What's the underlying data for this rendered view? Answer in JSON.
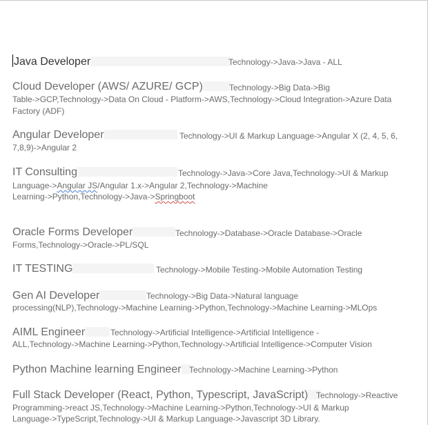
{
  "jobs": [
    {
      "title": "Java Developer",
      "lines": [
        "Technology->Java->Java - ALL"
      ]
    },
    {
      "title": "Cloud Developer (AWS/ AZURE/ GCP)",
      "lines": [
        "Technology->Big Data->Big",
        "Table->GCP,Technology->Data On Cloud - Platform->AWS,Technology->Cloud Integration->Azure Data",
        "Factory (ADF)"
      ]
    },
    {
      "title": "Angular Developer",
      "lines": [
        "Technology->UI & Markup Language->Angular X (2, 4, 5, 6,",
        "7,8,9)->Angular 2"
      ]
    },
    {
      "title": "IT Consulting",
      "lines": [
        "Technology->Java->Core Java,Technology->UI & Markup",
        "Language->",
        "Angular JS",
        "/Angular 1.x->Angular 2,Technology->Machine",
        "Learning->Python,Technology->Java->",
        "Springboot"
      ]
    },
    {
      "title": "Oracle Forms Developer",
      "lines": [
        "Technology->Database->Oracle Database->Oracle",
        "Forms,Technology->Oracle->PL/SQL"
      ]
    },
    {
      "title": "IT TESTING",
      "lines": [
        "Technology->Mobile Testing->Mobile Automation Testing"
      ]
    },
    {
      "title": "Gen AI Developer",
      "lines": [
        "Technology->Big Data->Natural language",
        "processing(NLP),Technology->Machine Learning->Python,Technology->Machine Learning->MLOps"
      ]
    },
    {
      "title": "AIML Engineer",
      "lines": [
        "Technology->Artificial Intelligence->Artificial Intelligence -",
        "ALL,Technology->Machine Learning->Python,Technology->Artificial Intelligence->Computer Vision"
      ]
    },
    {
      "title": "Python Machine learning Engineer",
      "lines": [
        "Technology->Machine Learning->Python"
      ]
    },
    {
      "title": "Full Stack Developer (React, Python, Typescript, JavaScript)",
      "lines": [
        "Technology->Reactive",
        "Programming->react JS,Technology->Machine Learning->Python,Technology->UI & Markup",
        "Language->TypeScript,Technology->UI & Markup Language->Javascript 3D Library."
      ]
    }
  ]
}
